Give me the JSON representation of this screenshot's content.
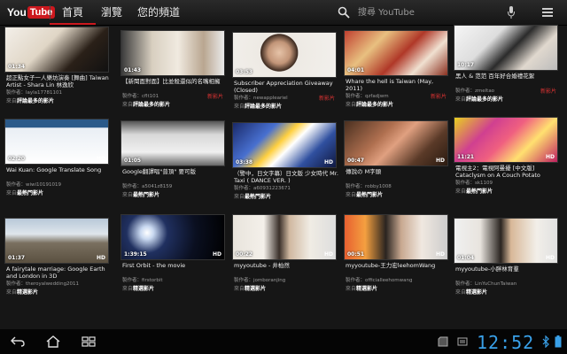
{
  "app": {
    "logo_you": "You",
    "logo_tube": "Tube",
    "tabs": [
      {
        "label": "首頁",
        "active": true
      },
      {
        "label": "瀏覽",
        "active": false
      },
      {
        "label": "您的頻道",
        "active": false
      }
    ],
    "search_placeholder": "搜尋 YouTube"
  },
  "videos": [
    {
      "title": "超正點女子一人樂坊演奏 [舞曲] Taiwan Artist - Shara Lin 林逸欣",
      "duration": "01:34",
      "hd": false,
      "author": "製作者：layla17781101",
      "feed_prefix": "來自",
      "feed": "評論最多的影片",
      "badge": ""
    },
    {
      "title": "【新聞面對面】比並殺還似的名嘴相擁",
      "duration": "01:43",
      "hd": false,
      "author": "製作者：cflt101",
      "feed_prefix": "來自",
      "feed": "評論最多的影片",
      "badge": "新影片"
    },
    {
      "title": "Subscriber Appreciation Giveaway (Closed)",
      "duration": "03:53",
      "hd": false,
      "author": "製作者：newappleariel",
      "feed_prefix": "來自",
      "feed": "評論最多的影片",
      "badge": "新影片"
    },
    {
      "title": "Whare the hell is Taiwan (May, 2011)",
      "duration": "04:01",
      "hd": false,
      "author": "製作者：qzfadjwm",
      "feed_prefix": "來自",
      "feed": "評論最多的影片",
      "badge": "新影片"
    },
    {
      "title": "黑人 & 范范 百年好合婚禮花絮",
      "duration": "10:17",
      "hd": false,
      "author": "製作者：zmeltao",
      "feed_prefix": "來自",
      "feed": "評論最多的影片",
      "badge": "新影片"
    },
    {
      "title": "Wai Kuan: Google Translate Song",
      "duration": "02:20",
      "hd": true,
      "author": "製作者：wiwi10191019",
      "feed_prefix": "來自",
      "feed": "最熱門影片",
      "badge": ""
    },
    {
      "title": "Google翻譯唱\"普頂\" 要可版",
      "duration": "01:05",
      "hd": false,
      "author": "製作者：a5041z8159",
      "feed_prefix": "來自",
      "feed": "最熱門影片",
      "badge": ""
    },
    {
      "title": "（警中，日文字幕）日文版 少女時代 Mr. Taxi ( DANCE VER. )",
      "duration": "03:38",
      "hd": true,
      "author": "製作者：a60931223671",
      "feed_prefix": "來自",
      "feed": "最熱門影片",
      "badge": ""
    },
    {
      "title": "傳說の M字頭",
      "duration": "00:47",
      "hd": true,
      "author": "製作者：robby1008",
      "feed_prefix": "來自",
      "feed": "最熱門影片",
      "badge": ""
    },
    {
      "title": "電視主2：電視阿曼擾 [中文版] Cataclysm on A Couch Potato [Chinese",
      "duration": "11:21",
      "hd": true,
      "author": "製作者：sk1109",
      "feed_prefix": "來自",
      "feed": "最熱門影片",
      "badge": ""
    },
    {
      "title": "A fairytale marriage: Google Earth and London in 3D",
      "duration": "01:37",
      "hd": true,
      "author": "製作者：theroyalwedding2011",
      "feed_prefix": "來自",
      "feed": "精選影片",
      "badge": ""
    },
    {
      "title": "First Orbit - the movie",
      "duration": "1:39:15",
      "hd": true,
      "author": "製作者：firstorbit",
      "feed_prefix": "來自",
      "feed": "精選影片",
      "badge": ""
    },
    {
      "title": "myyoutube - 井柏然",
      "duration": "00:22",
      "hd": true,
      "author": "製作者：jomboranjing",
      "feed_prefix": "來自",
      "feed": "精選影片",
      "badge": ""
    },
    {
      "title": "myyoutube-王力宏leehomWang",
      "duration": "00:51",
      "hd": true,
      "author": "製作者：officialleehomwang",
      "feed_prefix": "來自",
      "feed": "精選影片",
      "badge": ""
    },
    {
      "title": "myyoutube-小胖林育羣",
      "duration": "01:04",
      "hd": true,
      "author": "製作者：LinYuChunTaiwan",
      "feed_prefix": "來自",
      "feed": "精選影片",
      "badge": ""
    }
  ],
  "system": {
    "time": "12:52",
    "icons": [
      "back-icon",
      "home-icon",
      "recent-apps-icon",
      "sd-card-icon",
      "notification-icon",
      "bluetooth-icon",
      "battery-icon"
    ]
  },
  "colors": {
    "accent": "#cc181e",
    "clock": "#39a0e8",
    "badge": "#dd3333"
  }
}
